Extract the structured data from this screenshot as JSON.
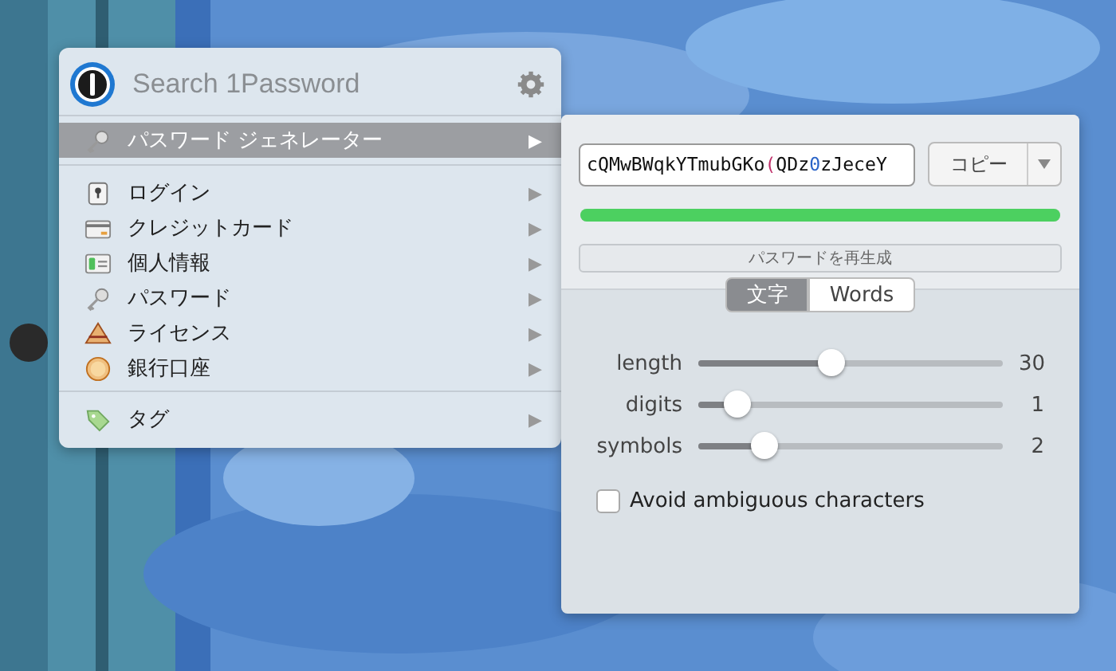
{
  "menu": {
    "search": {
      "placeholder": "Search 1Password"
    },
    "items": [
      {
        "label": "パスワード ジェネレーター",
        "kind": "key",
        "selected": true,
        "arrow": "▶"
      },
      {
        "label": "ログイン",
        "kind": "login",
        "selected": false,
        "arrow": "▶"
      },
      {
        "label": "クレジットカード",
        "kind": "card",
        "selected": false,
        "arrow": "▶"
      },
      {
        "label": "個人情報",
        "kind": "id",
        "selected": false,
        "arrow": "▶"
      },
      {
        "label": "パスワード",
        "kind": "key",
        "selected": false,
        "arrow": "▶"
      },
      {
        "label": "ライセンス",
        "kind": "license",
        "selected": false,
        "arrow": "▶"
      },
      {
        "label": "銀行口座",
        "kind": "bank",
        "selected": false,
        "arrow": "▶"
      },
      {
        "label": "タグ",
        "kind": "tag",
        "selected": false,
        "arrow": "▶"
      }
    ]
  },
  "generator": {
    "password": [
      {
        "text": "cQMwBWqkYTmubGKo",
        "kind": "letter"
      },
      {
        "text": "(",
        "kind": "symbol"
      },
      {
        "text": "QDz",
        "kind": "letter"
      },
      {
        "text": "0",
        "kind": "digit"
      },
      {
        "text": "zJeceY",
        "kind": "letter"
      }
    ],
    "copy_button": "コピー",
    "strength": {
      "level": 1.0
    },
    "regenerate_button": "パスワードを再生成",
    "tabs": [
      {
        "label": "文字",
        "selected": true
      },
      {
        "label": "Words",
        "selected": false
      }
    ],
    "sliders": [
      {
        "label": "length",
        "level": 0.44,
        "reading": "30"
      },
      {
        "label": "digits",
        "level": 0.13,
        "reading": "1"
      },
      {
        "label": "symbols",
        "level": 0.22,
        "reading": "2"
      }
    ],
    "avoid_ambiguous": {
      "label": "Avoid ambiguous characters",
      "checked": false
    }
  }
}
